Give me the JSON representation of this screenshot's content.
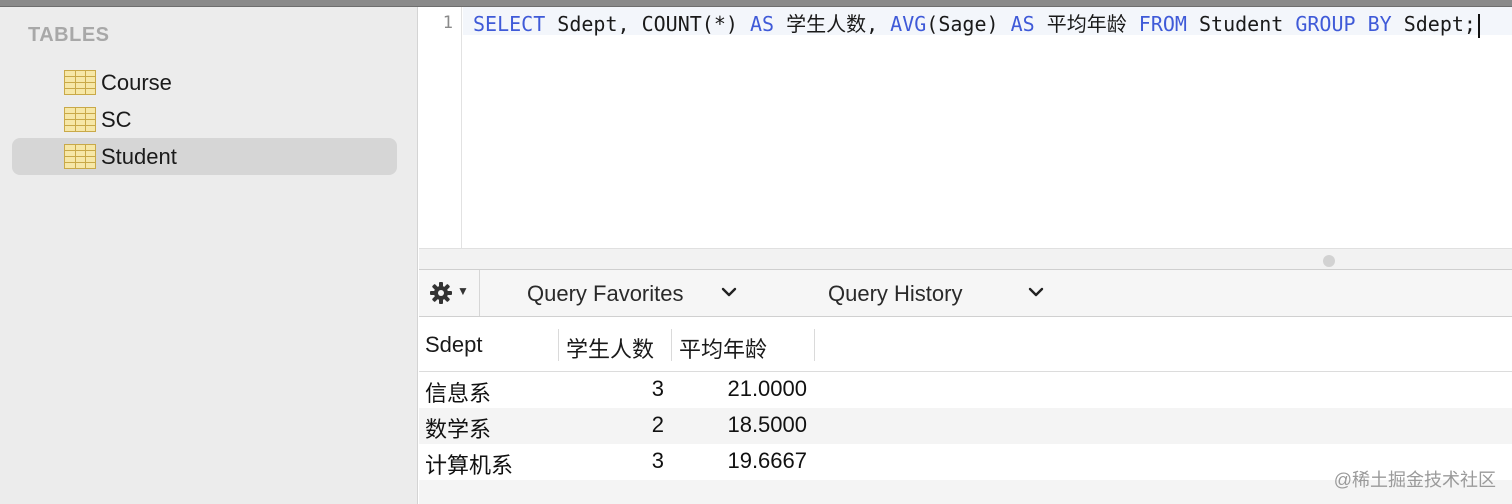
{
  "sidebar": {
    "header": "TABLES",
    "tables": [
      {
        "label": "Course",
        "selected": false
      },
      {
        "label": "SC",
        "selected": false
      },
      {
        "label": "Student",
        "selected": true
      }
    ]
  },
  "editor": {
    "line_number": "1",
    "tokens": [
      {
        "text": "SELECT",
        "kind": "keyword"
      },
      {
        "text": " Sdept, COUNT(*) ",
        "kind": "plain"
      },
      {
        "text": "AS",
        "kind": "keyword"
      },
      {
        "text": " 学生人数, ",
        "kind": "plain"
      },
      {
        "text": "AVG",
        "kind": "keyword"
      },
      {
        "text": "(Sage) ",
        "kind": "plain"
      },
      {
        "text": "AS",
        "kind": "keyword"
      },
      {
        "text": " 平均年龄 ",
        "kind": "plain"
      },
      {
        "text": "FROM",
        "kind": "keyword"
      },
      {
        "text": " Student ",
        "kind": "plain"
      },
      {
        "text": "GROUP",
        "kind": "keyword"
      },
      {
        "text": " ",
        "kind": "plain"
      },
      {
        "text": "BY",
        "kind": "keyword"
      },
      {
        "text": " Sdept;",
        "kind": "plain"
      }
    ]
  },
  "toolbar": {
    "gear_icon": "gear-icon",
    "query_favorites": "Query Favorites",
    "query_history": "Query History"
  },
  "results": {
    "columns": [
      "Sdept",
      "学生人数",
      "平均年龄"
    ],
    "rows": [
      [
        "信息系",
        "3",
        "21.0000"
      ],
      [
        "数学系",
        "2",
        "18.5000"
      ],
      [
        "计算机系",
        "3",
        "19.6667"
      ]
    ]
  },
  "watermark": "@稀土掘金技术社区",
  "colors": {
    "keyword": "#3f5ad8",
    "sidebar_bg": "#ececec",
    "selected_bg": "#d6d6d6"
  }
}
